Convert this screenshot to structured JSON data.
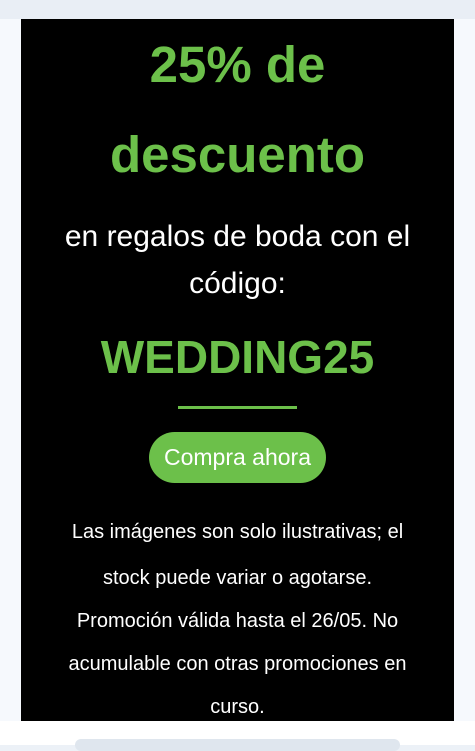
{
  "promo": {
    "headline_line1": "25% de",
    "headline_line2": "descuento",
    "subline_line1": "en regalos de boda con el",
    "subline_line2": "código:",
    "code": "WEDDING25",
    "cta_label": "Compra ahora",
    "disclaimer_lines": [
      "Las imágenes son solo ilustrativas; el",
      "stock puede variar o agotarse.",
      "Promoción válida hasta el 26/05. No",
      "acumulable con otras promociones en",
      "curso."
    ]
  },
  "colors": {
    "accent": "#6cc04a",
    "background": "#000000",
    "text": "#ffffff"
  }
}
